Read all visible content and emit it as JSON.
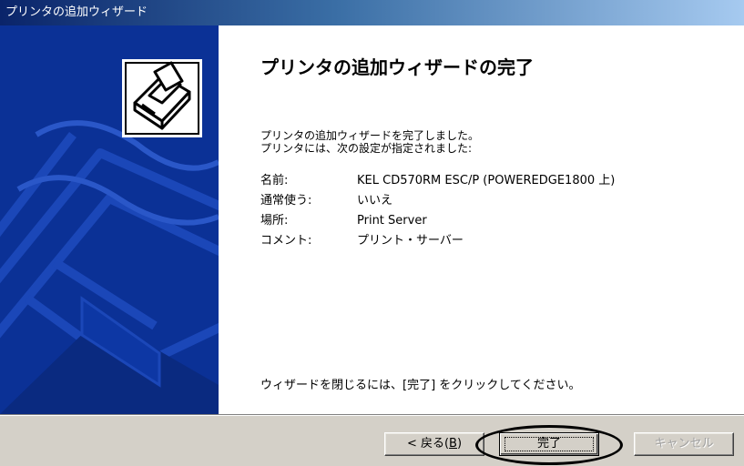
{
  "window": {
    "title": "プリンタの追加ウィザード"
  },
  "wizard": {
    "heading": "プリンタの追加ウィザードの完了",
    "intro_line1": "プリンタの追加ウィザードを完了しました。",
    "intro_line2": "プリンタには、次の設定が指定されました:",
    "settings": [
      {
        "label": "名前:",
        "value": "KEL CD570RM ESC/P (POWEREDGE1800 上)"
      },
      {
        "label": "通常使う:",
        "value": "いいえ"
      },
      {
        "label": "場所:",
        "value": "Print Server"
      },
      {
        "label": "コメント:",
        "value": "プリント・サーバー"
      }
    ],
    "footer_text": "ウィザードを閉じるには、[完了] をクリックしてください。"
  },
  "buttons": {
    "back_label": "< 戻る(",
    "back_accel": "B",
    "back_suffix": ")",
    "finish_label": "完了",
    "cancel_label": "キャンセル"
  },
  "colors": {
    "banner_blue": "#0b3196",
    "title_gradient_start": "#0a246a",
    "title_gradient_end": "#a6caf0",
    "dialog_gray": "#d4d0c8"
  },
  "icons": {
    "banner_icon": "printer-icon",
    "banner_background": "printer-outline-art"
  }
}
